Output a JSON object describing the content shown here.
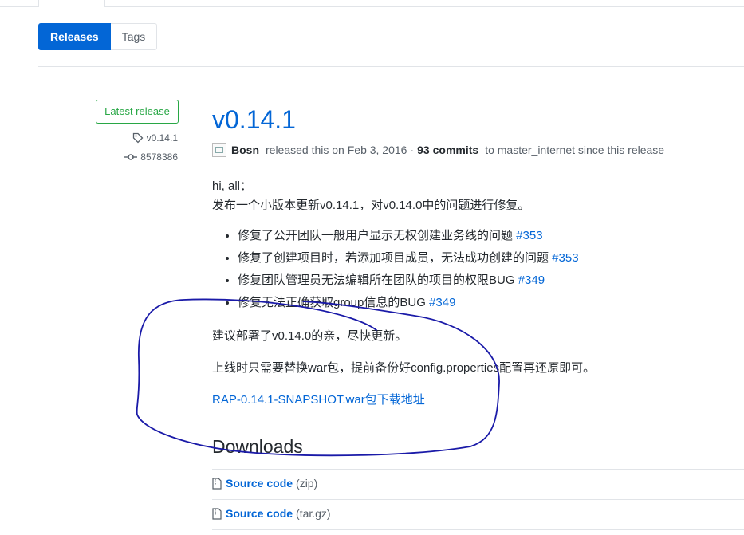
{
  "subnav": {
    "releases": "Releases",
    "tags": "Tags"
  },
  "sidebar": {
    "badge": "Latest release",
    "tag": "v0.14.1",
    "commit": "8578386"
  },
  "release": {
    "title": "v0.14.1",
    "author": "Bosn",
    "released_text": "released this on Feb 3, 2016",
    "separator": "·",
    "commits": "93 commits",
    "since_text": "to master_internet since this release"
  },
  "body": {
    "greeting": "hi, all：",
    "intro": "发布一个小版本更新v0.14.1，对v0.14.0中的问题进行修复。",
    "items": [
      {
        "text": "修复了公开团队一般用户显示无权创建业务线的问题 ",
        "issue": "#353"
      },
      {
        "text": "修复了创建项目时，若添加项目成员，无法成功创建的问题 ",
        "issue": "#353"
      },
      {
        "text": "修复团队管理员无法编辑所在团队的项目的权限BUG ",
        "issue": "#349"
      },
      {
        "text": "修复无法正确获取group信息的BUG ",
        "issue": "#349"
      }
    ],
    "suggest": "建议部署了v0.14.0的亲，尽快更新。",
    "deploy": "上线时只需要替换war包，提前备份好config.properties配置再还原即可。",
    "war_link": "RAP-0.14.1-SNAPSHOT.war包下载地址"
  },
  "downloads": {
    "title": "Downloads",
    "files": [
      {
        "name": "Source code",
        "format": "(zip)"
      },
      {
        "name": "Source code",
        "format": "(tar.gz)"
      }
    ]
  },
  "colors": {
    "link": "#0366d6",
    "badge": "#28a745",
    "annotation": "#1a1aa8"
  }
}
